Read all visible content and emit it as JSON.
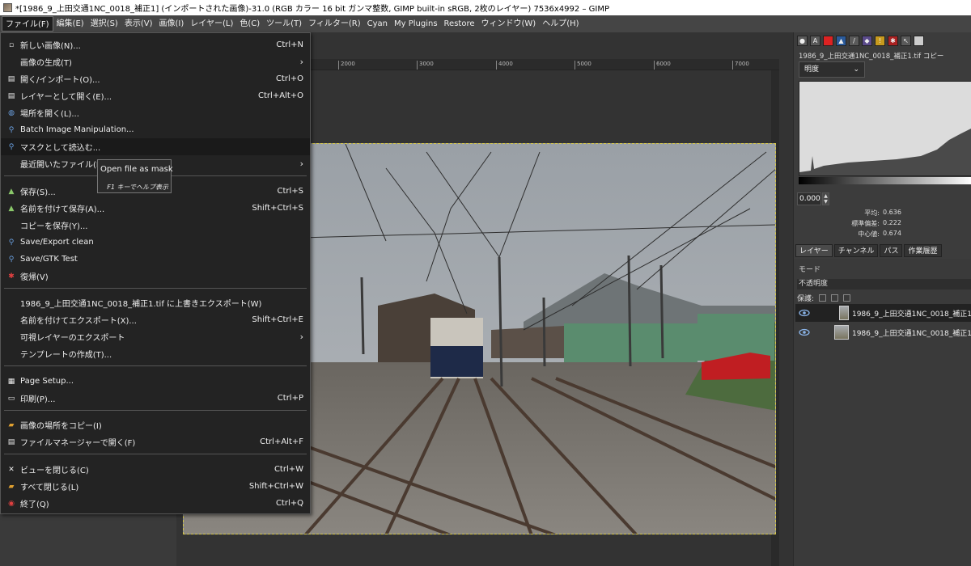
{
  "window": {
    "title": "*[1986_9_上田交通1NC_0018_補正1] (インポートされた画像)-31.0 (RGB カラー 16 bit ガンマ整数, GIMP built-in sRGB, 2枚のレイヤー) 7536x4992 – GIMP"
  },
  "menubar": [
    "ファイル(F)",
    "編集(E)",
    "選択(S)",
    "表示(V)",
    "画像(I)",
    "レイヤー(L)",
    "色(C)",
    "ツール(T)",
    "フィルター(R)",
    "Cyan",
    "My Plugins",
    "Restore",
    "ウィンドウ(W)",
    "ヘルプ(H)"
  ],
  "file_menu": {
    "items": [
      {
        "label": "新しい画像(N)...",
        "shortcut": "Ctrl+N",
        "icon": "new-image-icon"
      },
      {
        "label": "画像の生成(T)",
        "submenu": true,
        "icon": ""
      },
      {
        "label": "開く/インポート(O)...",
        "shortcut": "Ctrl+O",
        "icon": "open-icon"
      },
      {
        "label": "レイヤーとして開く(E)...",
        "shortcut": "Ctrl+Alt+O",
        "icon": "open-as-layers-icon"
      },
      {
        "label": "場所を開く(L)...",
        "icon": "open-location-icon"
      },
      {
        "label": "Batch Image Manipulation...",
        "icon": "plugin-icon"
      },
      {
        "label": "マスクとして読込む...",
        "icon": "plugin-icon",
        "highlighted": true
      },
      {
        "label": "最近開いたファイル(R)",
        "submenu": true,
        "icon": ""
      },
      {
        "label": "保存(S)...",
        "shortcut": "Ctrl+S",
        "icon": "save-icon"
      },
      {
        "label": "名前を付けて保存(A)...",
        "shortcut": "Shift+Ctrl+S",
        "icon": "save-as-icon"
      },
      {
        "label": "コピーを保存(Y)...",
        "icon": ""
      },
      {
        "label": "Save/Export clean",
        "icon": "plugin-icon"
      },
      {
        "label": "Save/GTK Test",
        "icon": "plugin-icon"
      },
      {
        "label": "復帰(V)",
        "icon": "revert-icon"
      },
      {
        "label": "1986_9_上田交通1NC_0018_補正1.tif に上書きエクスポート(W)",
        "icon": ""
      },
      {
        "label": "名前を付けてエクスポート(X)...",
        "shortcut": "Shift+Ctrl+E",
        "icon": ""
      },
      {
        "label": "可視レイヤーのエクスポート",
        "submenu": true,
        "icon": ""
      },
      {
        "label": "テンプレートの作成(T)...",
        "icon": ""
      },
      {
        "label": "Page Setup...",
        "icon": "page-setup-icon"
      },
      {
        "label": "印刷(P)...",
        "shortcut": "Ctrl+P",
        "icon": "print-icon"
      },
      {
        "label": "画像の場所をコピー(I)",
        "icon": "copy-location-icon"
      },
      {
        "label": "ファイルマネージャーで開く(F)",
        "shortcut": "Ctrl+Alt+F",
        "icon": "file-manager-icon"
      },
      {
        "label": "ビューを閉じる(C)",
        "shortcut": "Ctrl+W",
        "icon": "close-icon"
      },
      {
        "label": "すべて閉じる(L)",
        "shortcut": "Shift+Ctrl+W",
        "icon": "close-all-icon"
      },
      {
        "label": "終了(Q)",
        "shortcut": "Ctrl+Q",
        "icon": "quit-icon"
      }
    ],
    "tooltip": {
      "text": "Open file as mask",
      "help": "F1 キーでヘルプ表示"
    }
  },
  "ruler": {
    "ticks": [
      "2000",
      "3000",
      "4000",
      "5000",
      "6000",
      "7000"
    ]
  },
  "histogram": {
    "title": "1986_9_上田交通1NC_0018_補正1.tif コピー",
    "channel": "明度",
    "range_start": "0.000",
    "stats": [
      {
        "label": "平均:",
        "value": "0.636"
      },
      {
        "label": "標準偏差:",
        "value": "0.222"
      },
      {
        "label": "中心値:",
        "value": "0.674"
      }
    ]
  },
  "layers_panel": {
    "tabs": [
      "レイヤー",
      "チャンネル",
      "パス",
      "作業履歴"
    ],
    "mode_label": "モード",
    "opacity_label": "不透明度",
    "lock_label": "保護:",
    "layers": [
      {
        "name": "1986_9_上田交通1NC_0018_補正1",
        "selected": true
      },
      {
        "name": "1986_9_上田交通1NC_0018_補正1",
        "selected": false
      }
    ]
  }
}
